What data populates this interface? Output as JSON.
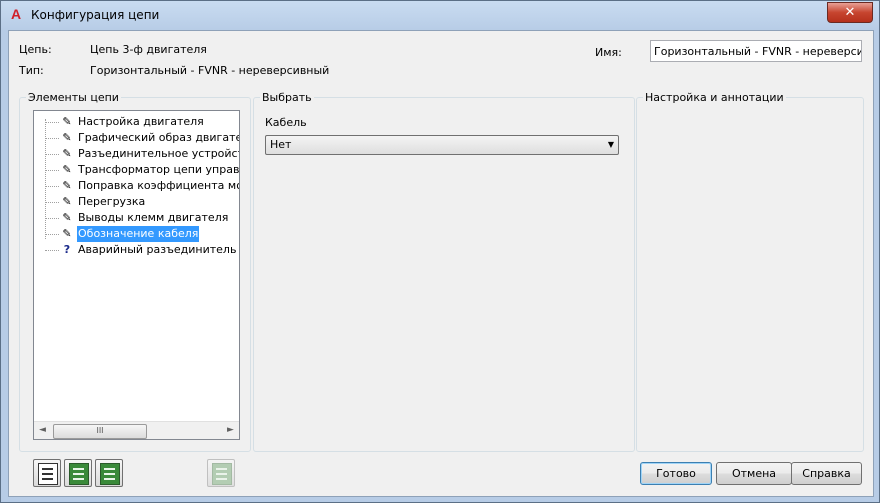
{
  "window": {
    "title": "Конфигурация цепи",
    "app_icon": "autocad-a-icon",
    "close_glyph": "✕"
  },
  "header": {
    "circuit_label": "Цепь:",
    "circuit_value": "Цепь 3-ф двигателя",
    "type_label": "Тип:",
    "type_value": "Горизонтальный - FVNR - нереверсивный",
    "name_label": "Имя:",
    "name_value": "Горизонтальный - FVNR - нереверсивный"
  },
  "elements_panel": {
    "title": "Элементы цепи",
    "items": [
      {
        "label": "Настройка двигателя",
        "icon": "pencil-icon"
      },
      {
        "label": "Графический образ двигателя",
        "icon": "pencil-icon"
      },
      {
        "label": "Разъединительное устройство",
        "icon": "pencil-icon"
      },
      {
        "label": "Трансформатор цепи управления",
        "icon": "pencil-icon"
      },
      {
        "label": "Поправка коэффициента мощности",
        "icon": "pencil-icon"
      },
      {
        "label": "Перегрузка",
        "icon": "pencil-icon"
      },
      {
        "label": "Выводы клемм двигателя",
        "icon": "pencil-icon"
      },
      {
        "label": "Обозначение кабеля",
        "icon": "pencil-icon",
        "selected": true
      },
      {
        "label": "Аварийный разъединитель по месту",
        "icon": "question-icon"
      }
    ],
    "scroll_left": "◄",
    "scroll_right": "►",
    "scroll_thumb": "III"
  },
  "select_panel": {
    "title": "Выбрать",
    "cable_label": "Кабель",
    "cable_value": "Нет",
    "dropdown_glyph": "▼"
  },
  "settings_panel": {
    "title": "Настройка и аннотации"
  },
  "buttons": {
    "ok": "Готово",
    "cancel": "Отмена",
    "help": "Справка"
  },
  "colors": {
    "selection": "#3399ff",
    "close_button": "#c7452f",
    "tool_icon_green": "#3a8a3a"
  }
}
